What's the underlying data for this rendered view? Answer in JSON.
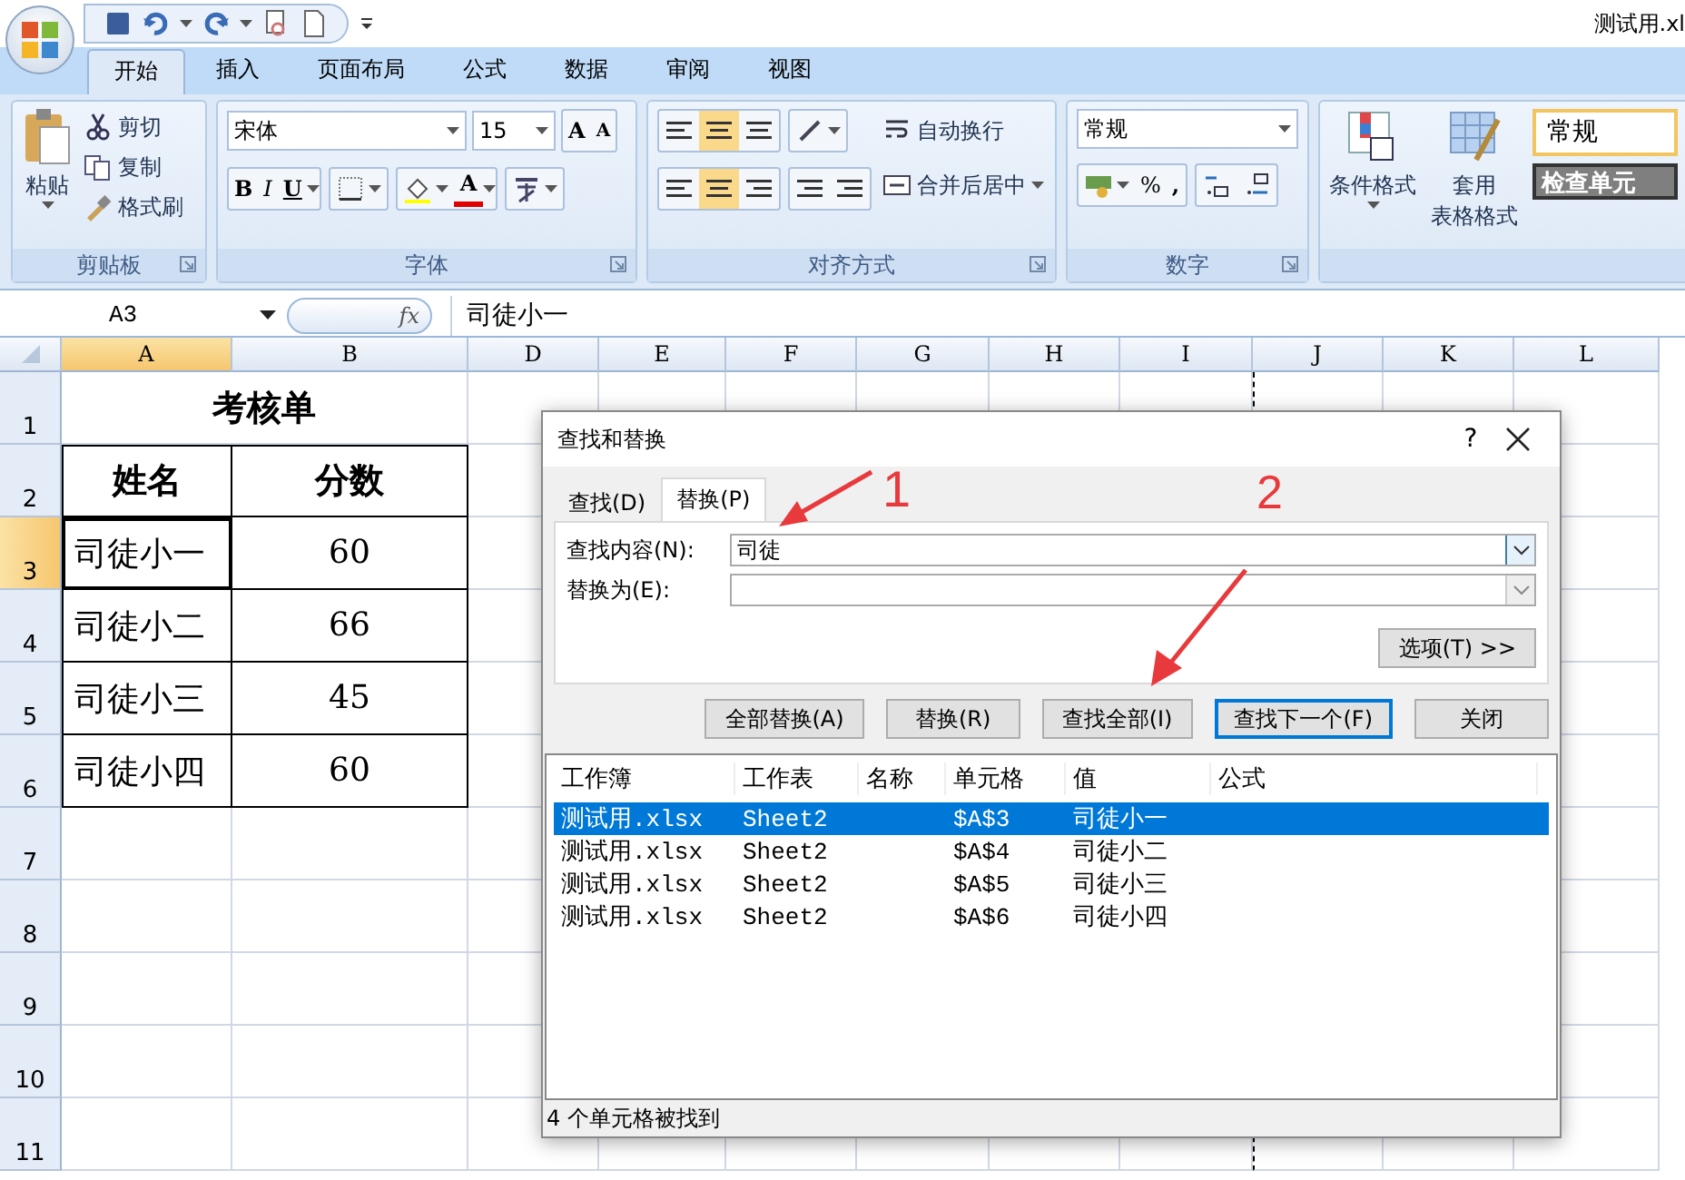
{
  "window": {
    "title": "测试用.xl"
  },
  "ribbon_tabs": [
    {
      "label": "开始",
      "selected": true
    },
    {
      "label": "插入",
      "selected": false
    },
    {
      "label": "页面布局",
      "selected": false
    },
    {
      "label": "公式",
      "selected": false
    },
    {
      "label": "数据",
      "selected": false
    },
    {
      "label": "审阅",
      "selected": false
    },
    {
      "label": "视图",
      "selected": false
    }
  ],
  "clipboard": {
    "paste": "粘贴",
    "cut": "剪切",
    "copy": "复制",
    "format_painter": "格式刷",
    "label": "剪贴板"
  },
  "font": {
    "family": "宋体",
    "size": "15",
    "grow": "A",
    "shrink": "A",
    "bold": "B",
    "italic": "I",
    "underline": "U",
    "font_color": "A",
    "label": "字体"
  },
  "alignment": {
    "wrap": "自动换行",
    "merge": "合并后居中",
    "label": "对齐方式"
  },
  "number": {
    "format": "常规",
    "percent": "%",
    "comma": ",",
    "label": "数字"
  },
  "styles": {
    "conditional": "条件格式",
    "table_format": [
      "套用",
      "表格格式"
    ],
    "normal": "常规",
    "check_cell": "检查单元"
  },
  "formula_bar": {
    "name_box": "A3",
    "fx": "fx",
    "value": "司徒小一"
  },
  "columns": [
    {
      "label": "A",
      "selected": true
    },
    {
      "label": "B",
      "selected": false
    },
    {
      "label": "D",
      "selected": false
    },
    {
      "label": "E",
      "selected": false
    },
    {
      "label": "F",
      "selected": false
    },
    {
      "label": "G",
      "selected": false
    },
    {
      "label": "H",
      "selected": false
    },
    {
      "label": "I",
      "selected": false
    },
    {
      "label": "J",
      "selected": false
    },
    {
      "label": "K",
      "selected": false
    },
    {
      "label": "L",
      "selected": false
    }
  ],
  "rows": [
    {
      "label": "1",
      "selected": false
    },
    {
      "label": "2",
      "selected": false
    },
    {
      "label": "3",
      "selected": true
    },
    {
      "label": "4",
      "selected": false
    },
    {
      "label": "5",
      "selected": false
    },
    {
      "label": "6",
      "selected": false
    },
    {
      "label": "7",
      "selected": false
    },
    {
      "label": "8",
      "selected": false
    },
    {
      "label": "9",
      "selected": false
    },
    {
      "label": "10",
      "selected": false
    },
    {
      "label": "11",
      "selected": false
    }
  ],
  "sheet": {
    "title": "考核单",
    "header": [
      "姓名",
      "分数"
    ],
    "data": [
      [
        "司徒小一",
        "60"
      ],
      [
        "司徒小二",
        "66"
      ],
      [
        "司徒小三",
        "45"
      ],
      [
        "司徒小四",
        "60"
      ]
    ]
  },
  "dialog": {
    "title": "查找和替换",
    "help": "?",
    "tabs": [
      {
        "label": "查找(D)",
        "selected": false
      },
      {
        "label": "替换(P)",
        "selected": true
      }
    ],
    "find_label": "查找内容(N):",
    "find_value": "司徒",
    "replace_label": "替换为(E):",
    "options": "选项(T) >>",
    "buttons": [
      {
        "label": "全部替换(A)",
        "default": false
      },
      {
        "label": "替换(R)",
        "default": false
      },
      {
        "label": "查找全部(I)",
        "default": false
      },
      {
        "label": "查找下一个(F)",
        "default": true
      },
      {
        "label": "关闭",
        "default": false
      }
    ],
    "columns": [
      "工作簿",
      "工作表",
      "名称",
      "单元格",
      "值",
      "公式"
    ],
    "results": [
      {
        "cells": [
          "测试用.xlsx",
          "Sheet2",
          "",
          "$A$3",
          "司徒小一",
          ""
        ],
        "selected": true
      },
      {
        "cells": [
          "测试用.xlsx",
          "Sheet2",
          "",
          "$A$4",
          "司徒小二",
          ""
        ],
        "selected": false
      },
      {
        "cells": [
          "测试用.xlsx",
          "Sheet2",
          "",
          "$A$5",
          "司徒小三",
          ""
        ],
        "selected": false
      },
      {
        "cells": [
          "测试用.xlsx",
          "Sheet2",
          "",
          "$A$6",
          "司徒小四",
          ""
        ],
        "selected": false
      }
    ],
    "status": "4 个单元格被找到"
  },
  "annotations": [
    {
      "label": "1"
    },
    {
      "label": "2"
    }
  ]
}
